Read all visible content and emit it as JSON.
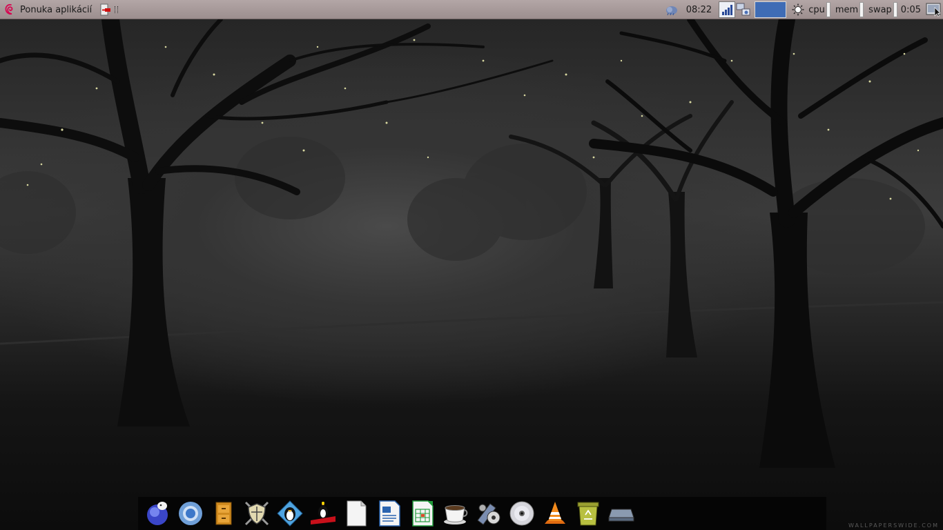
{
  "panel": {
    "menu_label": "Ponuka aplikácií",
    "clock": "08:22",
    "meters": [
      {
        "label": "cpu"
      },
      {
        "label": "mem"
      },
      {
        "label": "swap"
      }
    ],
    "uptime": "0:05"
  },
  "desktop": {
    "watermark": "WALLPAPERSWIDE.COM"
  },
  "dock": {
    "items": [
      {
        "icon": "seamonkey-icon"
      },
      {
        "icon": "chromium-icon"
      },
      {
        "icon": "file-manager-icon"
      },
      {
        "icon": "shield-swords-icon"
      },
      {
        "icon": "penguin-game-icon"
      },
      {
        "icon": "tux-racer-icon"
      },
      {
        "icon": "blank-document-icon"
      },
      {
        "icon": "writer-document-icon"
      },
      {
        "icon": "calc-spreadsheet-icon"
      },
      {
        "icon": "coffee-cup-icon"
      },
      {
        "icon": "video-editor-icon"
      },
      {
        "icon": "optical-disc-icon"
      },
      {
        "icon": "vlc-cone-icon"
      },
      {
        "icon": "trash-icon"
      },
      {
        "icon": "drive-icon"
      }
    ]
  },
  "colors": {
    "panel": "#a89a9a",
    "pager_active": "#3f6cb5",
    "debian_red": "#d70751"
  }
}
